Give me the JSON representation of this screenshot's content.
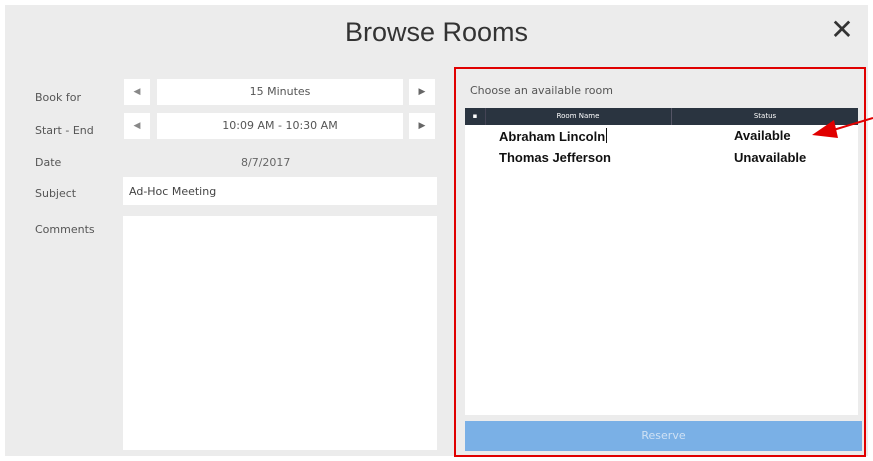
{
  "dialog": {
    "title": "Browse Rooms",
    "close_icon": "close-icon"
  },
  "form": {
    "book_for_label": "Book for",
    "book_for_value": "15 Minutes",
    "start_end_label": "Start - End",
    "start_end_value": "10:09 AM - 10:30 AM",
    "date_label": "Date",
    "date_value": "8/7/2017",
    "subject_label": "Subject",
    "subject_value": "Ad-Hoc Meeting",
    "comments_label": "Comments",
    "comments_value": ""
  },
  "rooms": {
    "heading": "Choose an available room",
    "columns": [
      "Room Name",
      "Status"
    ],
    "rows": [
      {
        "name": "Abraham Lincoln",
        "status": "Available"
      },
      {
        "name": "Thomas Jefferson",
        "status": "Unavailable"
      }
    ],
    "reserve_label": "Reserve"
  },
  "colors": {
    "highlight_border": "#e00000",
    "header_bg": "#2a3440",
    "reserve_bg": "#7ab0e6"
  }
}
